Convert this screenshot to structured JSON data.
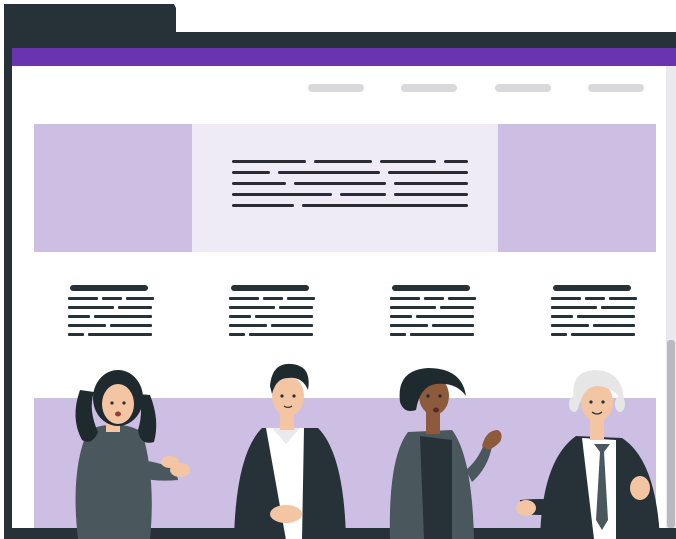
{
  "colors": {
    "accent": "#6a34b0",
    "purple_light": "#cdbfe4",
    "purple_pale": "#efebf6",
    "frame": "#263238"
  },
  "icons": [
    "folder-tab-icon"
  ],
  "header": {
    "nav_items": [
      "",
      "",
      "",
      ""
    ]
  },
  "hero": {
    "text_lines": 5
  },
  "columns": {
    "count": 4
  },
  "people": [
    "woman-clapping",
    "man-in-blazer",
    "woman-gesturing",
    "older-man-in-suit"
  ]
}
